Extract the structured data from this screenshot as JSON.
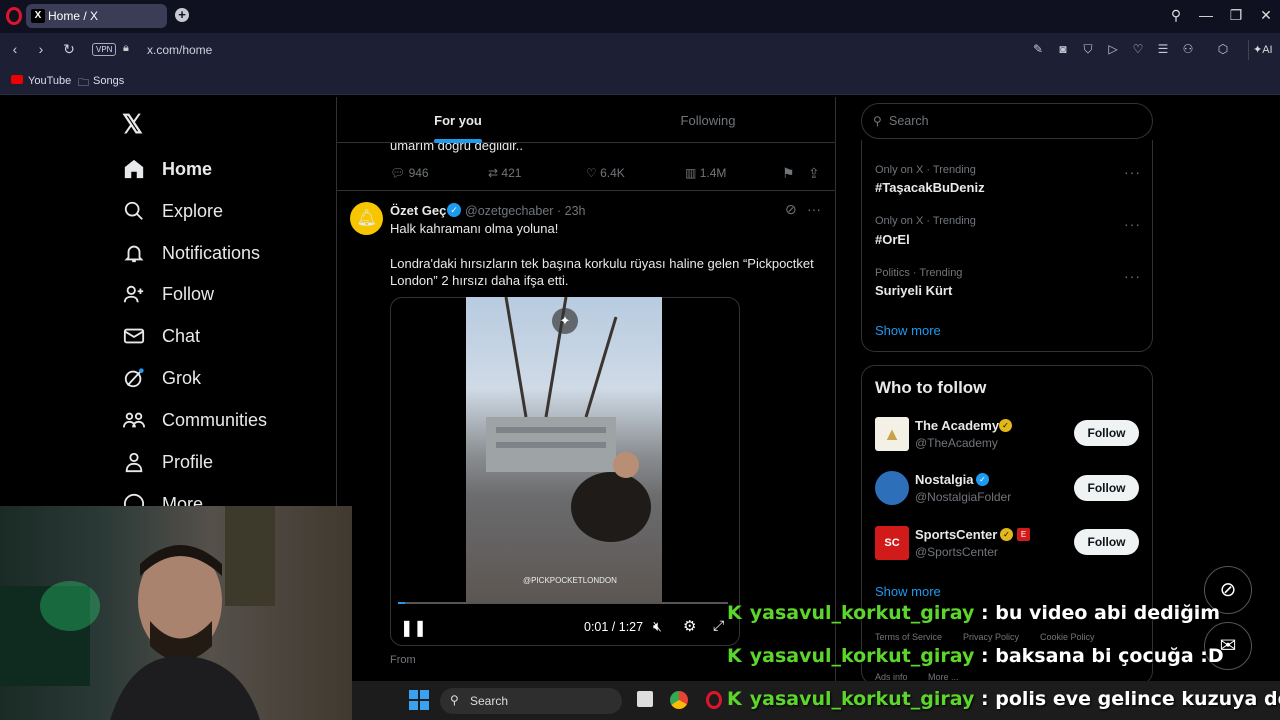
{
  "browser": {
    "tab_title": "Home / X",
    "tab_x": "X",
    "tab_close": "×",
    "new_tab": "+",
    "vpn": "VPN",
    "url": "x.com/home",
    "ai_label": "AI",
    "bookmarks": [
      {
        "label": "YouTube",
        "icon": "youtube-icon"
      },
      {
        "label": "Songs",
        "icon": "folder-icon"
      }
    ]
  },
  "nav": {
    "logo": "𝕏",
    "items": [
      {
        "label": "Home",
        "icon": "home-icon"
      },
      {
        "label": "Explore",
        "icon": "search-icon"
      },
      {
        "label": "Notifications",
        "icon": "bell-icon"
      },
      {
        "label": "Follow",
        "icon": "person-add-icon"
      },
      {
        "label": "Chat",
        "icon": "mail-icon"
      },
      {
        "label": "Grok",
        "icon": "grok-icon"
      },
      {
        "label": "Communities",
        "icon": "communities-icon"
      },
      {
        "label": "Profile",
        "icon": "profile-icon"
      },
      {
        "label": "More",
        "icon": "more-icon"
      }
    ]
  },
  "feed": {
    "tabs": [
      "For you",
      "Following"
    ],
    "prev_tweet_text": "umarım doğru değildir..",
    "prev_stats": {
      "replies": "946",
      "reposts": "421",
      "likes": "6.4K",
      "views": "1.4M"
    },
    "tweet": {
      "author": "Özet Geç",
      "handle": "@ozetgechaber",
      "time": "· 23h",
      "line1": "Halk kahramanı olma yoluna!",
      "line2": "Londra'daki hırsızların tek başına korkulu rüyası haline gelen “Pickpoctket London” 2 hırsızı daha ifşa etti.",
      "watermark": "@PICKPOCKETLONDON",
      "time_display": "0:01 / 1:27",
      "progress": 0.02,
      "from": "From"
    }
  },
  "right": {
    "search_placeholder": "Search",
    "trends": [
      {
        "category": "Only on X · Trending",
        "name": "#TaşacakBuDeniz"
      },
      {
        "category": "Only on X · Trending",
        "name": "#OrEl"
      },
      {
        "category": "Politics · Trending",
        "name": "Suriyeli Kürt"
      }
    ],
    "show_more": "Show more",
    "wtf_title": "Who to follow",
    "accounts": [
      {
        "name": "The Academy",
        "handle": "@TheAcademy",
        "badge": "gold",
        "avatar_color": "#f3f0e6"
      },
      {
        "name": "Nostalgia",
        "handle": "@NostalgiaFolder",
        "badge": "blue",
        "avatar_color": "#2d6fb8"
      },
      {
        "name": "SportsCenter",
        "handle": "@SportsCenter",
        "badge": "gold",
        "avatar_color": "#d11a1a"
      }
    ],
    "follow_label": "Follow",
    "wtf_show_more": "Show more",
    "footer_links": [
      "Terms of Service",
      "Privacy Policy",
      "Cookie Policy"
    ],
    "footer2": [
      "Ads info",
      "More ..."
    ]
  },
  "taskbar": {
    "search": "Search"
  },
  "chat": [
    {
      "user": "yasavul_korkut_giray",
      "msg": ": bu video abi dediğim"
    },
    {
      "user": "yasavul_korkut_giray",
      "msg": ": baksana bi çocuğa :D"
    },
    {
      "user": "yasavul_korkut_giray",
      "msg": ": polis eve gelince kuzuya dö"
    }
  ],
  "colors": {
    "accent": "#1d9bf0",
    "chat_user": "#5dd62c",
    "background": "#000000"
  }
}
